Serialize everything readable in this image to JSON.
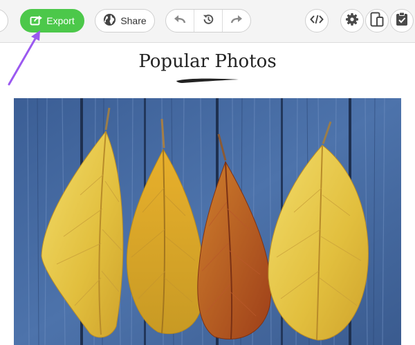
{
  "toolbar": {
    "export_label": "Export",
    "share_label": "Share"
  },
  "page": {
    "title": "Popular Photos"
  },
  "colors": {
    "accent": "#4cc84a",
    "annotation": "#9b59f0",
    "wood": "#45679d"
  },
  "icons": {
    "export": "export-icon",
    "share": "globe-icon",
    "undo": "undo-icon",
    "history": "history-icon",
    "redo": "redo-icon",
    "code": "code-icon",
    "settings": "gear-icon",
    "preview": "devices-icon",
    "clipboard": "clipboard-icon"
  }
}
